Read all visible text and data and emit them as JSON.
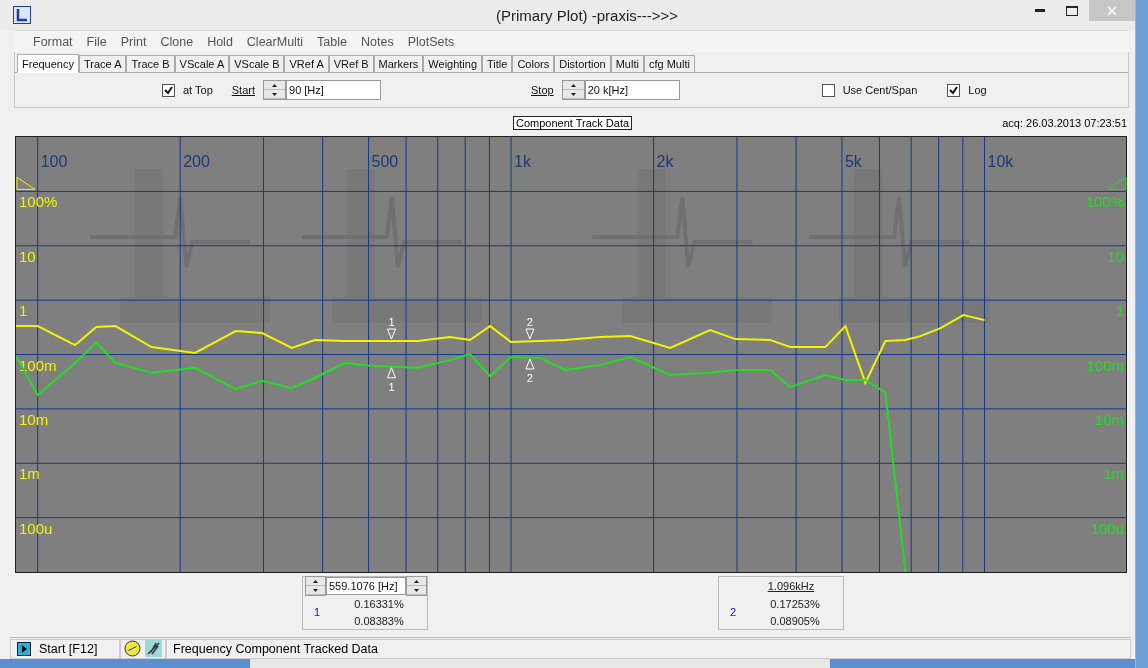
{
  "window": {
    "title": "(Primary Plot) -praxis--->>>"
  },
  "menu": [
    "Format",
    "File",
    "Print",
    "Clone",
    "Hold",
    "ClearMulti",
    "Table",
    "Notes",
    "PlotSets"
  ],
  "tabs": [
    {
      "label": "Frequency",
      "selected": true
    },
    {
      "label": "Trace A",
      "selected": false
    },
    {
      "label": "Trace B",
      "selected": false
    },
    {
      "label": "VScale A",
      "selected": false
    },
    {
      "label": "VScale B",
      "selected": false
    },
    {
      "label": "VRef A",
      "selected": false
    },
    {
      "label": "VRef B",
      "selected": false
    },
    {
      "label": "Markers",
      "selected": false
    },
    {
      "label": "Weighting",
      "selected": false
    },
    {
      "label": "Title",
      "selected": false
    },
    {
      "label": "Colors",
      "selected": false
    },
    {
      "label": "Distortion",
      "selected": false
    },
    {
      "label": "Multi",
      "selected": false
    },
    {
      "label": "cfg Multi",
      "selected": false
    }
  ],
  "controls": {
    "at_top": {
      "label": "at Top",
      "checked": true
    },
    "start": {
      "label": "Start",
      "value": "90 [Hz]"
    },
    "stop": {
      "label": "Stop",
      "value": "20 k[Hz]"
    },
    "use_cent_span": {
      "label": "Use Cent/Span",
      "checked": false
    },
    "log": {
      "label": "Log",
      "checked": true
    }
  },
  "plot": {
    "title": "Component Track Data",
    "acq": "acq: 26.03.2013 07:23:51",
    "frequency_labels": [
      "100",
      "200",
      "500",
      "1k",
      "2k",
      "5k",
      "10k"
    ],
    "left_labels": [
      "100%",
      "10",
      "1",
      "100m",
      "10m",
      "1m",
      "100u"
    ],
    "right_labels": [
      "100%",
      "10",
      "1",
      "100m",
      "10m",
      "1m",
      "100u"
    ],
    "traces": [
      {
        "color": "#f4f400"
      },
      {
        "color": "#22dd22"
      }
    ],
    "markers": [
      {
        "labels": [
          "1",
          "1"
        ]
      },
      {
        "labels": [
          "2",
          "2"
        ]
      }
    ]
  },
  "readouts": [
    {
      "kind": "spinner",
      "marker": "1",
      "frequency": "559.1076 [Hz]",
      "values": [
        "0.16331%",
        "0.08383%"
      ]
    },
    {
      "kind": "link",
      "marker": "2",
      "frequency": "1.096kHz",
      "values": [
        "0.17253%",
        "0.08905%"
      ]
    }
  ],
  "status_bar": {
    "start": "Start [F12]",
    "message": "Frequency Component Tracked Data"
  }
}
